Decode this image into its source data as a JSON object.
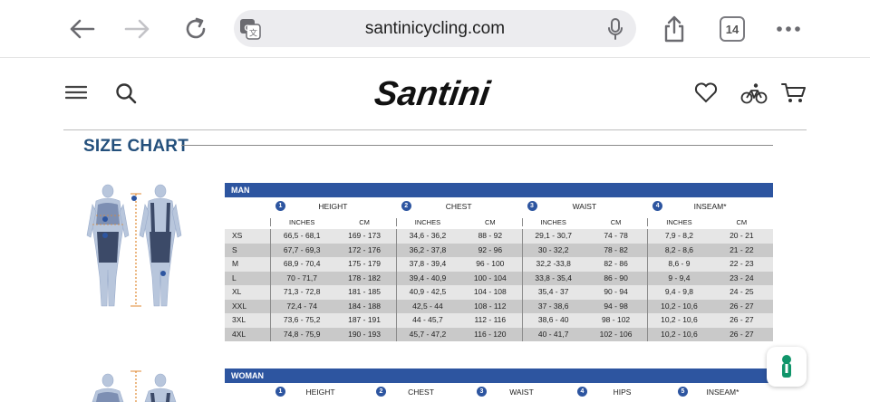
{
  "browser": {
    "url": "santinicycling.com",
    "tabs_count": "14"
  },
  "site": {
    "logo_text": "Santini"
  },
  "size_chart": {
    "title": "SIZE CHART",
    "man": {
      "label": "MAN",
      "measures": [
        {
          "num": "1",
          "label": "HEIGHT"
        },
        {
          "num": "2",
          "label": "CHEST"
        },
        {
          "num": "3",
          "label": "WAIST"
        },
        {
          "num": "4",
          "label": "INSEAM*"
        }
      ],
      "units": [
        "INCHES",
        "CM",
        "INCHES",
        "CM",
        "INCHES",
        "CM",
        "INCHES",
        "CM"
      ],
      "rows": [
        [
          "XS",
          "66,5 - 68,1",
          "169 - 173",
          "34,6 - 36,2",
          "88 - 92",
          "29,1 - 30,7",
          "74 - 78",
          "7,9 - 8,2",
          "20 - 21"
        ],
        [
          "S",
          "67,7 - 69,3",
          "172 - 176",
          "36,2 - 37,8",
          "92 - 96",
          "30 - 32,2",
          "78 - 82",
          "8,2 - 8,6",
          "21 - 22"
        ],
        [
          "M",
          "68,9 - 70,4",
          "175 - 179",
          "37,8 - 39,4",
          "96 - 100",
          "32,2 -33,8",
          "82 - 86",
          "8,6 - 9",
          "22 - 23"
        ],
        [
          "L",
          "70 - 71,7",
          "178 - 182",
          "39,4 - 40,9",
          "100 - 104",
          "33,8 - 35,4",
          "86 - 90",
          "9 - 9,4",
          "23 - 24"
        ],
        [
          "XL",
          "71,3 - 72,8",
          "181 - 185",
          "40,9 - 42,5",
          "104 - 108",
          "35,4 - 37",
          "90 - 94",
          "9,4 - 9,8",
          "24 - 25"
        ],
        [
          "XXL",
          "72,4 - 74",
          "184 - 188",
          "42,5 - 44",
          "108 - 112",
          "37 - 38,6",
          "94 - 98",
          "10,2 - 10,6",
          "26 - 27"
        ],
        [
          "3XL",
          "73,6 - 75,2",
          "187 - 191",
          "44 - 45,7",
          "112 - 116",
          "38,6 - 40",
          "98 - 102",
          "10,2 - 10,6",
          "26 - 27"
        ],
        [
          "4XL",
          "74,8 - 75,9",
          "190 - 193",
          "45,7 - 47,2",
          "116 - 120",
          "40 - 41,7",
          "102 - 106",
          "10,2 - 10,6",
          "26 - 27"
        ]
      ]
    },
    "woman": {
      "label": "WOMAN",
      "measures": [
        {
          "num": "1",
          "label": "HEIGHT"
        },
        {
          "num": "2",
          "label": "CHEST"
        },
        {
          "num": "3",
          "label": "WAIST"
        },
        {
          "num": "4",
          "label": "HIPS"
        },
        {
          "num": "5",
          "label": "INSEAM*"
        }
      ]
    }
  },
  "icons": [
    "back-arrow-icon",
    "forward-arrow-icon",
    "reload-icon",
    "translate-icon",
    "microphone-icon",
    "share-icon",
    "more-icon",
    "menu-icon",
    "search-icon",
    "heart-icon",
    "bike-icon",
    "cart-icon",
    "help-icon"
  ],
  "colors": {
    "brand_blue": "#2d55a0",
    "title_blue": "#24507c",
    "help_green": "#10956a"
  }
}
